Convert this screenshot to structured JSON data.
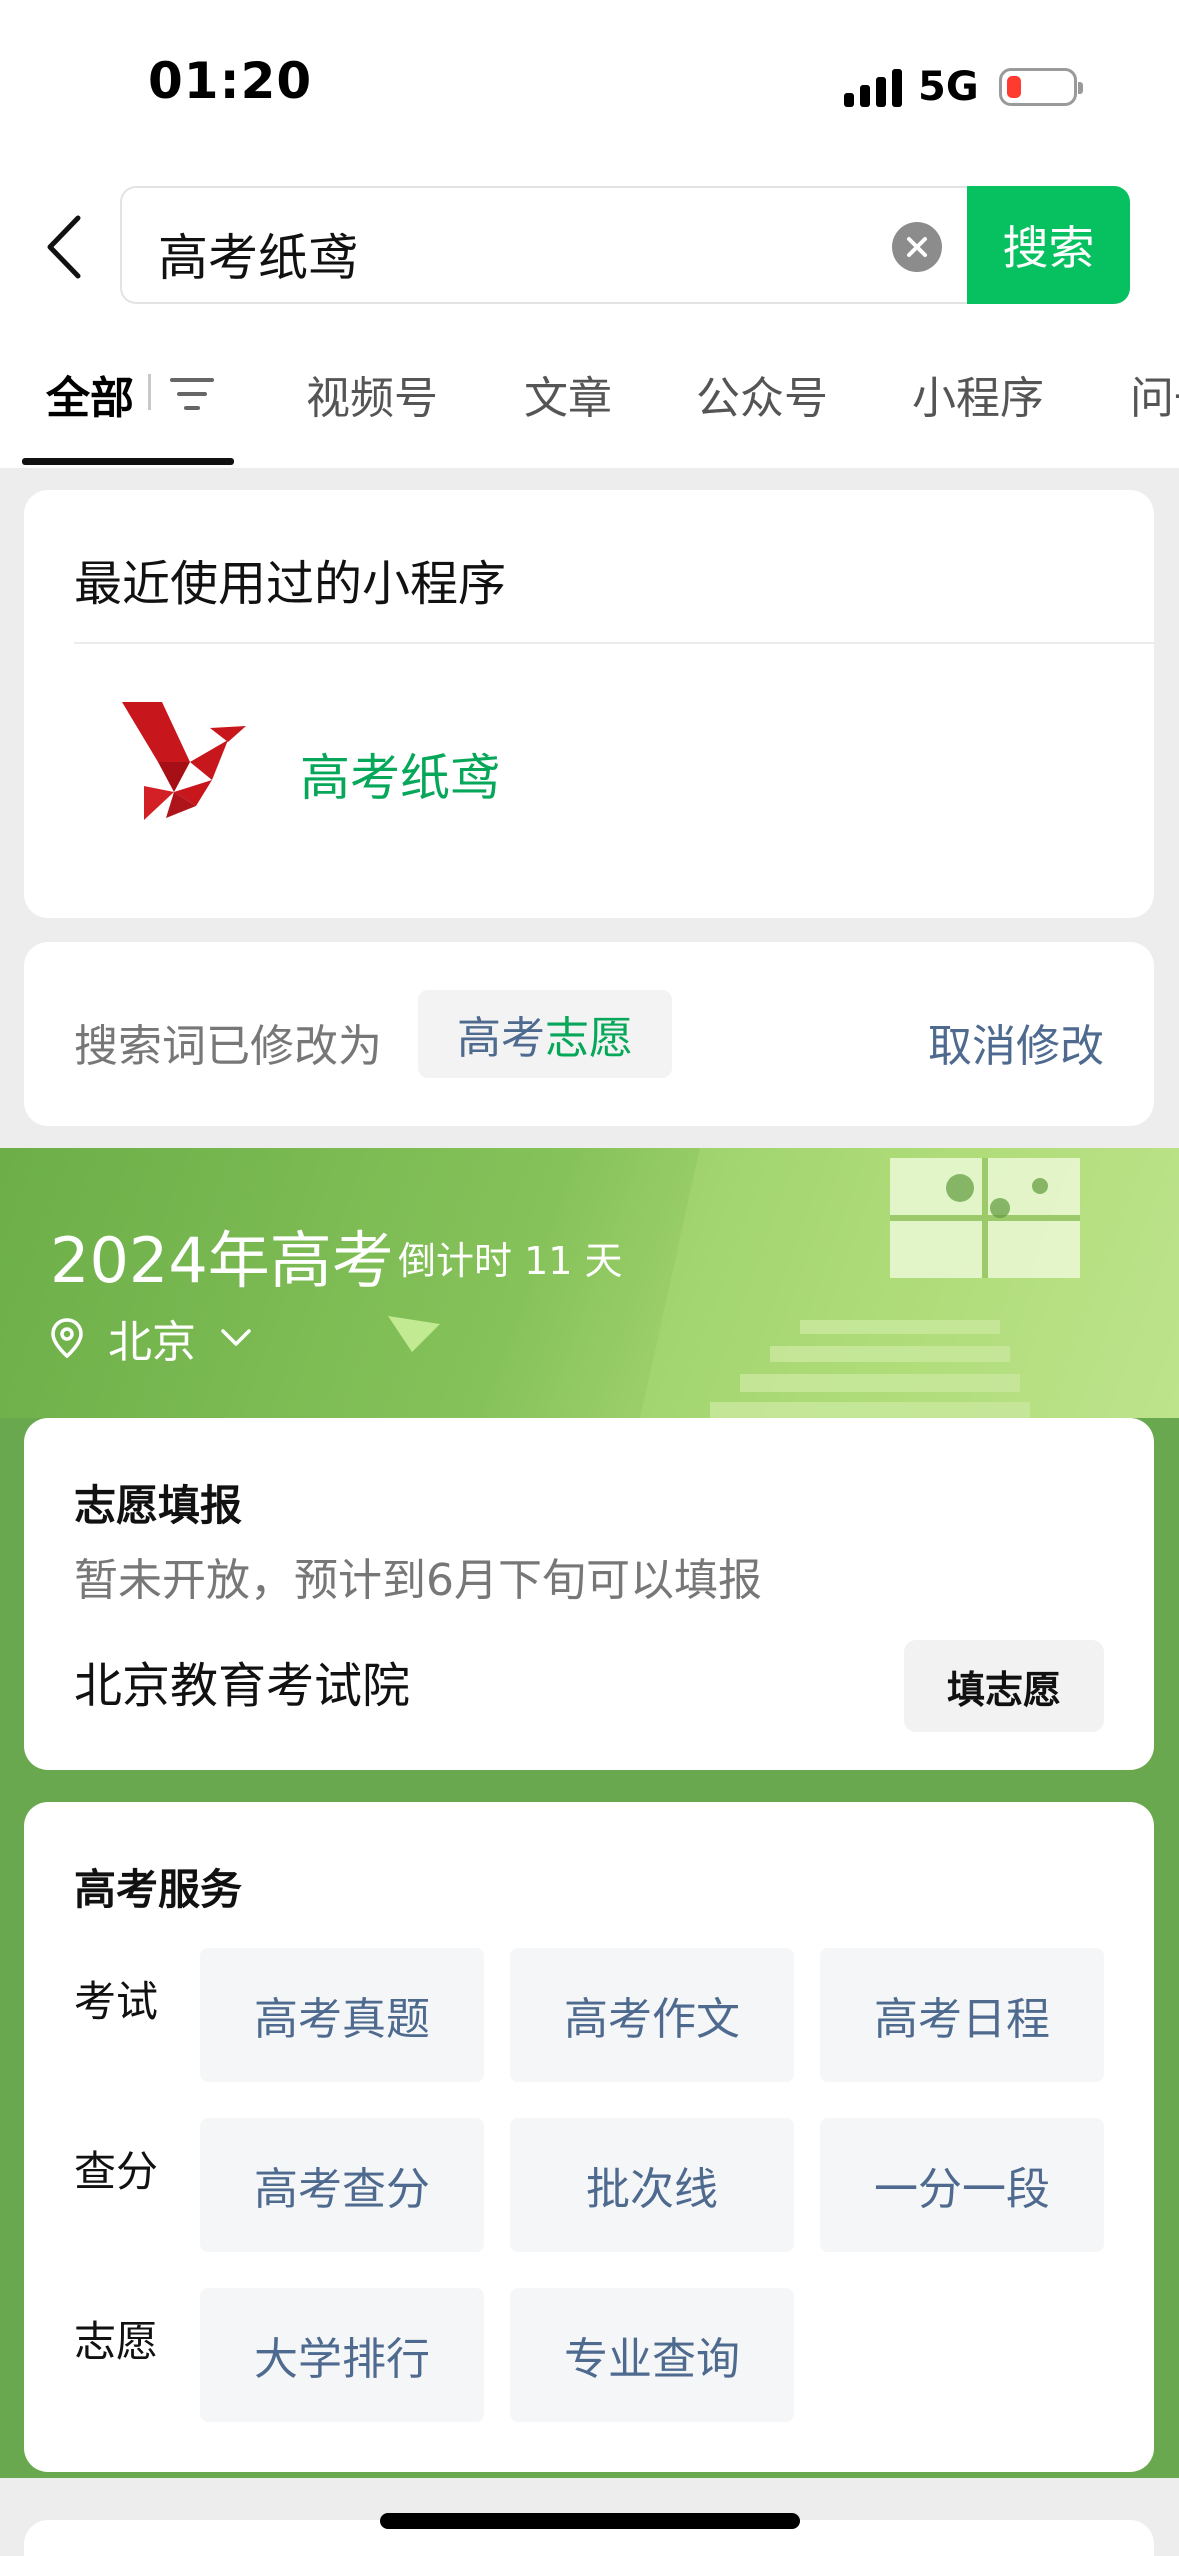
{
  "status_bar": {
    "time": "01:20",
    "network": "5G"
  },
  "search": {
    "query": "高考纸鸢",
    "button_label": "搜索"
  },
  "tabs": [
    {
      "label": "全部"
    },
    {
      "label": "视频号"
    },
    {
      "label": "文章"
    },
    {
      "label": "公众号"
    },
    {
      "label": "小程序"
    },
    {
      "label": "问一"
    }
  ],
  "recent": {
    "title": "最近使用过的小程序",
    "app_name": "高考纸鸢"
  },
  "modify": {
    "label": "搜索词已修改为",
    "term_part1": "高考",
    "term_part2": "志愿",
    "cancel": "取消修改"
  },
  "gaokao": {
    "title": "2024年高考",
    "countdown": "倒计时 11 天",
    "location": "北京",
    "apply": {
      "title": "志愿填报",
      "subtitle": "暂未开放，预计到6月下旬可以填报",
      "org": "北京教育考试院",
      "button": "填志愿"
    },
    "services": {
      "title": "高考服务",
      "rows": [
        {
          "label": "考试",
          "items": [
            "高考真题",
            "高考作文",
            "高考日程"
          ]
        },
        {
          "label": "查分",
          "items": [
            "高考查分",
            "批次线",
            "一分一段"
          ]
        },
        {
          "label": "志愿",
          "items": [
            "大学排行",
            "专业查询"
          ]
        }
      ]
    }
  },
  "colors": {
    "accent_green": "#07c160",
    "link_blue": "#4f6a8f",
    "hero_green": "#6aa84f",
    "battery_low": "#ff3b30"
  },
  "icons": [
    "back-chevron-icon",
    "clear-icon",
    "filter-icon",
    "kite-logo-icon",
    "location-pin-icon",
    "chevron-down-icon"
  ]
}
